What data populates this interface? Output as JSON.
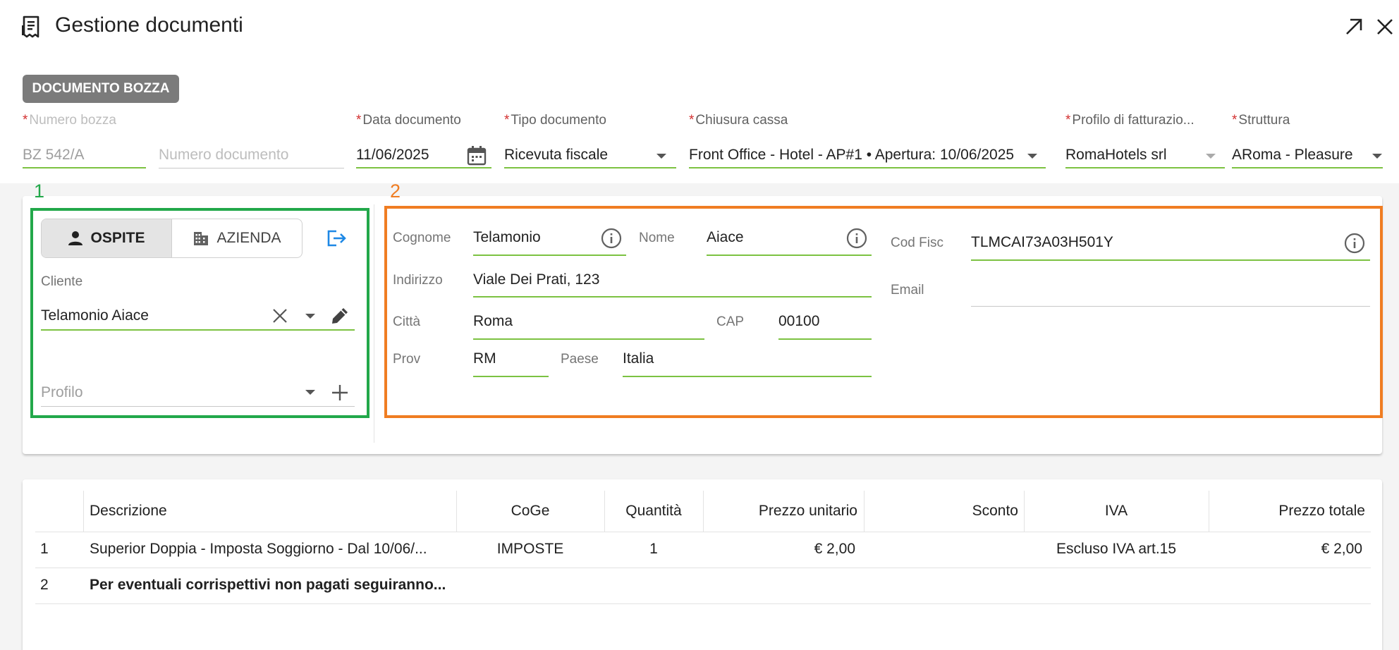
{
  "header": {
    "title": "Gestione documenti",
    "icons": {
      "title": "document-receipt-icon",
      "expand": "arrow-up-right-icon",
      "close": "close-icon"
    }
  },
  "badge": "DOCUMENTO BOZZA",
  "fields": {
    "numero_bozza": {
      "required_mark": "*",
      "label": "Numero bozza",
      "value": "BZ 542/A"
    },
    "numero_documento": {
      "placeholder": "Numero documento"
    },
    "data_documento": {
      "required_mark": "*",
      "label": "Data documento",
      "value": "11/06/2025"
    },
    "tipo_documento": {
      "required_mark": "*",
      "label": "Tipo documento",
      "value": "Ricevuta fiscale"
    },
    "chiusura_cassa": {
      "required_mark": "*",
      "label": "Chiusura cassa",
      "value": "Front Office - Hotel - AP#1 • Apertura: 10/06/2025"
    },
    "profilo_fatturazione": {
      "required_mark": "*",
      "label": "Profilo di fatturazio...",
      "value": "RomaHotels srl"
    },
    "struttura": {
      "required_mark": "*",
      "label": "Struttura",
      "value": "ARoma - Pleasure"
    }
  },
  "annotations": {
    "box1": "1",
    "box2": "2",
    "box1_color": "#22a84a",
    "box2_color": "#f07d22"
  },
  "client_panel": {
    "toggle": [
      {
        "label": "OSPITE",
        "icon": "person-icon",
        "active": true
      },
      {
        "label": "AZIENDA",
        "icon": "building-icon",
        "active": false
      }
    ],
    "cliente_label": "Cliente",
    "cliente_value": "Telamonio Aiace",
    "profilo_placeholder": "Profilo"
  },
  "guest": {
    "cognome": {
      "label": "Cognome",
      "value": "Telamonio"
    },
    "nome": {
      "label": "Nome",
      "value": "Aiace"
    },
    "cod_fisc": {
      "label": "Cod Fisc",
      "value": "TLMCAI73A03H501Y"
    },
    "indirizzo": {
      "label": "Indirizzo",
      "value": "Viale Dei Prati, 123"
    },
    "email": {
      "label": "Email",
      "value": ""
    },
    "citta": {
      "label": "Città",
      "value": "Roma"
    },
    "cap": {
      "label": "CAP",
      "value": "00100"
    },
    "prov": {
      "label": "Prov",
      "value": "RM"
    },
    "paese": {
      "label": "Paese",
      "value": "Italia"
    }
  },
  "table": {
    "headers": [
      "",
      "Descrizione",
      "CoGe",
      "Quantità",
      "Prezzo unitario",
      "Sconto",
      "IVA",
      "Prezzo totale"
    ],
    "rows": [
      {
        "n": "1",
        "descrizione": "Superior Doppia - Imposta Soggiorno - Dal 10/06/...",
        "coge": "IMPOSTE",
        "quantita": "1",
        "prezzo_unitario": "€ 2,00",
        "sconto": "",
        "iva": "Escluso IVA art.15",
        "prezzo_totale": "€ 2,00"
      },
      {
        "n": "2",
        "descrizione": "Per eventuali corrispettivi non pagati seguiranno...",
        "coge": "",
        "quantita": "",
        "prezzo_unitario": "",
        "sconto": "",
        "iva": "",
        "prezzo_totale": ""
      }
    ]
  },
  "colors": {
    "accent_green": "#7cc242",
    "required_red": "#d32f2f",
    "link_blue": "#1e88e5",
    "badge_grey": "#7b7b7b"
  }
}
